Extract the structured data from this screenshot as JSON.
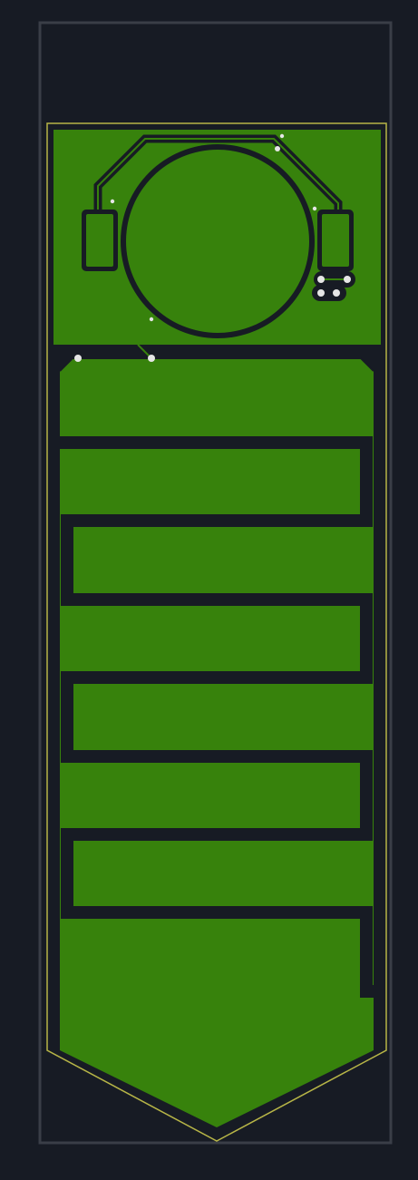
{
  "view": {
    "background_color": "#171b24",
    "frame_color": "#3a3e47",
    "board_outline_color": "#b7b547",
    "copper_color": "#37820c",
    "gap_color": "#171b24",
    "trace_color": "#37820c",
    "via_color": "#e6e6e6"
  },
  "board": {
    "moisture_sensor_fingers": 4,
    "mounting_vias": 4
  }
}
